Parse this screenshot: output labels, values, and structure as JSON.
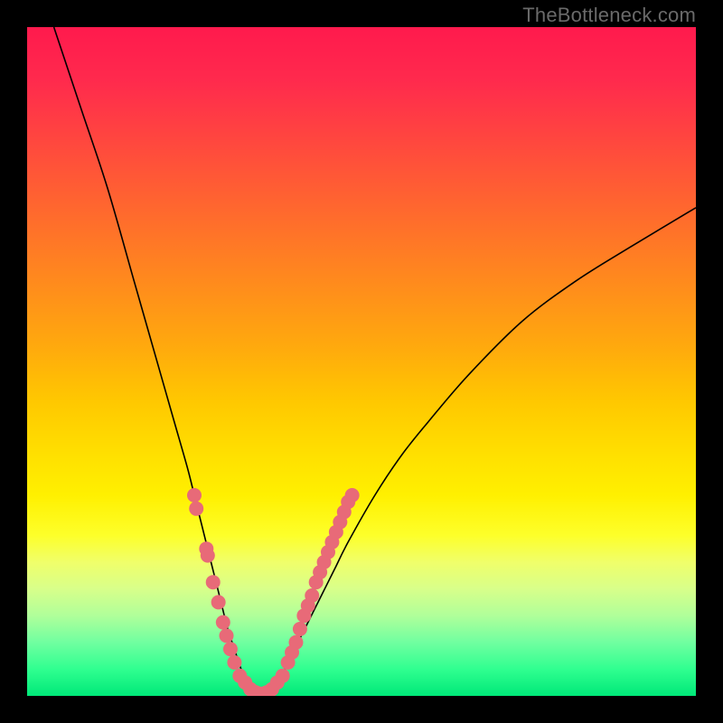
{
  "watermark": "TheBottleneck.com",
  "chart_data": {
    "type": "line",
    "title": "",
    "xlabel": "",
    "ylabel": "",
    "xlim": [
      0,
      100
    ],
    "ylim": [
      0,
      100
    ],
    "background_gradient": {
      "top": "#ff1a4d",
      "mid": "#ffe000",
      "bottom": "#00e878"
    },
    "series": [
      {
        "name": "left-curve",
        "x": [
          4,
          8,
          12,
          16,
          18,
          20,
          22,
          24,
          25,
          26,
          27,
          28,
          29,
          30,
          31,
          32,
          33,
          34,
          35
        ],
        "y": [
          100,
          88,
          76,
          62,
          55,
          48,
          41,
          34,
          30,
          26,
          22,
          18,
          14,
          10,
          7,
          4,
          2,
          1,
          0
        ]
      },
      {
        "name": "right-curve",
        "x": [
          35,
          36,
          37,
          38,
          39,
          40,
          42,
          44,
          46,
          48,
          52,
          56,
          60,
          66,
          74,
          82,
          90,
          100
        ],
        "y": [
          0,
          1,
          2,
          3,
          5,
          7,
          11,
          15,
          19,
          23,
          30,
          36,
          41,
          48,
          56,
          62,
          67,
          73
        ]
      }
    ],
    "datapoints": [
      {
        "x": 25.0,
        "y": 30
      },
      {
        "x": 25.3,
        "y": 28
      },
      {
        "x": 26.8,
        "y": 22
      },
      {
        "x": 27.0,
        "y": 21
      },
      {
        "x": 27.8,
        "y": 17
      },
      {
        "x": 28.6,
        "y": 14
      },
      {
        "x": 29.3,
        "y": 11
      },
      {
        "x": 29.8,
        "y": 9
      },
      {
        "x": 30.4,
        "y": 7
      },
      {
        "x": 31.0,
        "y": 5
      },
      {
        "x": 31.8,
        "y": 3
      },
      {
        "x": 32.6,
        "y": 2
      },
      {
        "x": 33.4,
        "y": 1
      },
      {
        "x": 34.2,
        "y": 0.5
      },
      {
        "x": 35.0,
        "y": 0.3
      },
      {
        "x": 35.8,
        "y": 0.5
      },
      {
        "x": 36.6,
        "y": 1
      },
      {
        "x": 37.4,
        "y": 2
      },
      {
        "x": 38.2,
        "y": 3
      },
      {
        "x": 39.0,
        "y": 5
      },
      {
        "x": 39.6,
        "y": 6.5
      },
      {
        "x": 40.2,
        "y": 8
      },
      {
        "x": 40.8,
        "y": 10
      },
      {
        "x": 41.4,
        "y": 12
      },
      {
        "x": 42.0,
        "y": 13.5
      },
      {
        "x": 42.6,
        "y": 15
      },
      {
        "x": 43.2,
        "y": 17
      },
      {
        "x": 43.8,
        "y": 18.5
      },
      {
        "x": 44.4,
        "y": 20
      },
      {
        "x": 45.0,
        "y": 21.5
      },
      {
        "x": 45.6,
        "y": 23
      },
      {
        "x": 46.2,
        "y": 24.5
      },
      {
        "x": 46.8,
        "y": 26
      },
      {
        "x": 47.4,
        "y": 27.5
      },
      {
        "x": 48.0,
        "y": 29
      },
      {
        "x": 48.6,
        "y": 30
      }
    ],
    "marker_radius": 8,
    "marker_color": "#e86a78",
    "curve_color": "#000000"
  }
}
